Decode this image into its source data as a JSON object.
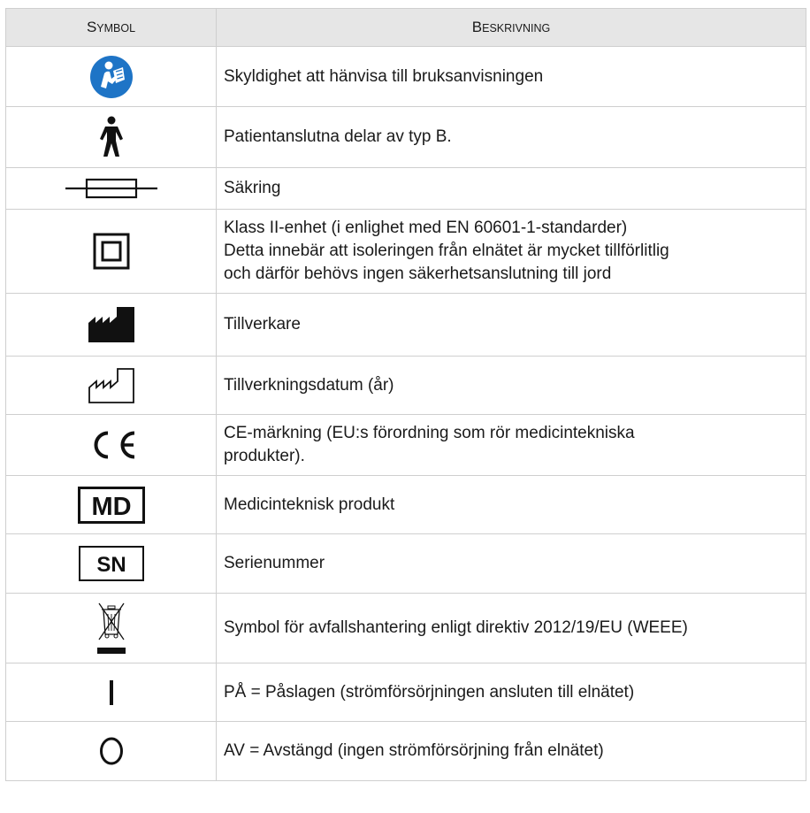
{
  "header": {
    "symbol_first": "S",
    "symbol_rest": "YMBOL",
    "desc_first": "B",
    "desc_rest": "ESKRIVNING"
  },
  "rows": [
    {
      "icon": "manual-icon",
      "color": "#1e74c6",
      "lines": [
        "Skyldighet att hänvisa till bruksanvisningen"
      ]
    },
    {
      "icon": "type-b-applied-part-icon",
      "lines": [
        "Patientanslutna delar av typ B."
      ]
    },
    {
      "icon": "fuse-icon",
      "lines": [
        "Säkring"
      ]
    },
    {
      "icon": "class-ii-icon",
      "lines": [
        "Klass II-enhet (i enlighet med EN 60601-1-standarder)",
        "Detta innebär att isoleringen från elnätet är mycket tillförlitlig",
        "och därför behövs ingen säkerhetsanslutning till jord"
      ]
    },
    {
      "icon": "manufacturer-icon",
      "lines": [
        "Tillverkare"
      ]
    },
    {
      "icon": "manufacture-date-icon",
      "lines": [
        "Tillverkningsdatum (år)"
      ]
    },
    {
      "icon": "ce-mark-icon",
      "lines": [
        "CE-märkning (EU:s förordning som rör medicintekniska",
        "produkter)."
      ]
    },
    {
      "icon": "md-icon",
      "badge": "MD",
      "lines": [
        "Medicinteknisk produkt"
      ]
    },
    {
      "icon": "serial-number-icon",
      "badge": "SN",
      "lines": [
        "Serienummer"
      ]
    },
    {
      "icon": "weee-icon",
      "lines": [
        "Symbol för avfallshantering enligt direktiv 2012/19/EU (WEEE)"
      ]
    },
    {
      "icon": "power-on-icon",
      "lines": [
        "PÅ = Påslagen (strömförsörjningen ansluten till elnätet)"
      ]
    },
    {
      "icon": "power-off-icon",
      "lines": [
        "AV = Avstängd (ingen strömförsörjning från elnätet)"
      ]
    }
  ]
}
